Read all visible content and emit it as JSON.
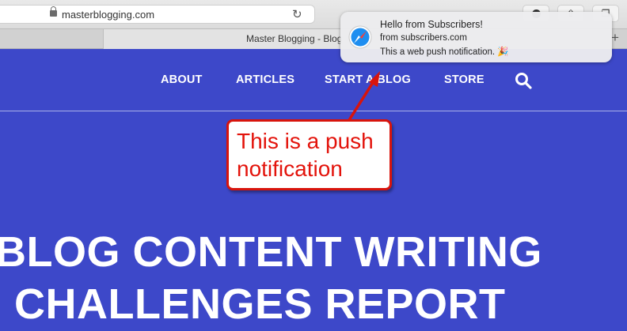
{
  "browser": {
    "url": "masterblogging.com",
    "tab_title": "Master Blogging - Blog"
  },
  "nav": {
    "items": [
      "ABOUT",
      "ARTICLES",
      "START A BLOG",
      "STORE"
    ]
  },
  "hero": {
    "line1": "BLOG CONTENT WRITING",
    "line2": "CHALLENGES REPORT"
  },
  "notification": {
    "title": "Hello from Subscribers!",
    "from": "from subscribers.com",
    "body": "This a web push notification. 🎉"
  },
  "annotation": {
    "line1": "This is a push",
    "line2": "notification"
  },
  "colors": {
    "page_background": "#3d48c9",
    "annotation_red": "#d8140c"
  }
}
